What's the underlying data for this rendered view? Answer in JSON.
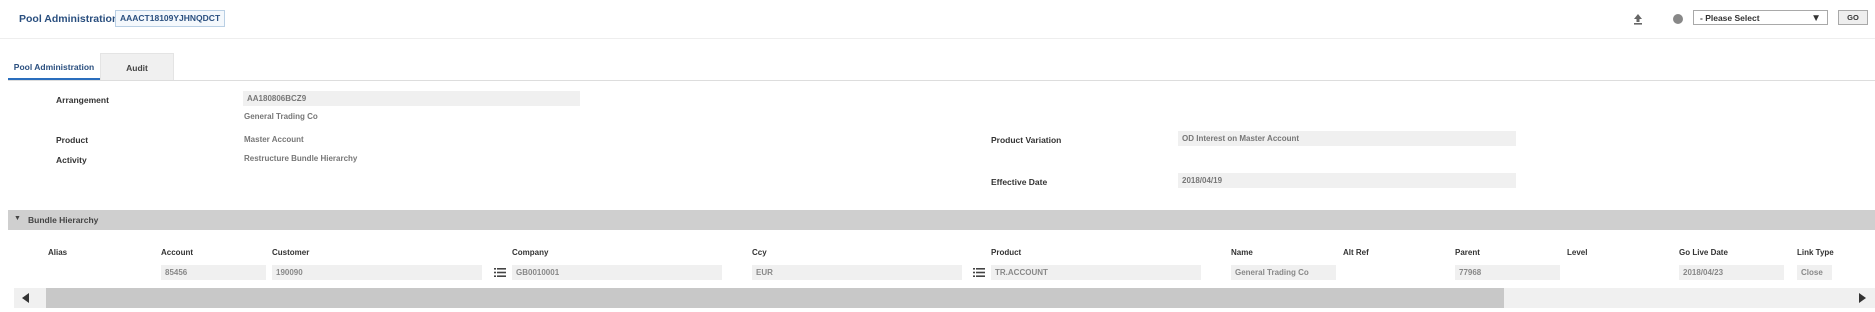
{
  "header": {
    "title": "Pool Administration",
    "reference": "AAACT18109YJHNQDCT",
    "icons": [
      "upload-icon",
      "info-icon"
    ],
    "select_value": "- Please Select",
    "go_label": "GO"
  },
  "tabs": [
    {
      "label": "Pool Administration",
      "active": true
    },
    {
      "label": "Audit",
      "active": false
    }
  ],
  "details": {
    "arrangement_label": "Arrangement",
    "arrangement_value": "AA180806BCZ9",
    "arrangement_sub": "General Trading Co",
    "product_label": "Product",
    "product_value": "Master Account",
    "activity_label": "Activity",
    "activity_value": "Restructure Bundle Hierarchy",
    "product_variation_label": "Product Variation",
    "product_variation_value": "OD Interest on Master Account",
    "effective_date_label": "Effective Date",
    "effective_date_value": "2018/04/19"
  },
  "bundle": {
    "section_title": "Bundle Hierarchy",
    "columns": [
      "Alias",
      "Account",
      "Customer",
      "Company",
      "Ccy",
      "Product",
      "Name",
      "Alt Ref",
      "Parent",
      "Level",
      "Go Live Date",
      "Link Type"
    ],
    "row": {
      "alias": "",
      "account": "85456",
      "customer": "190090",
      "company": "GB0010001",
      "ccy": "EUR",
      "product": "TR.ACCOUNT",
      "name": "General Trading Co",
      "alt_ref": "",
      "parent": "77968",
      "level": "",
      "go_live_date": "2018/04/23",
      "link_type": "Close"
    }
  },
  "colors": {
    "accent": "#2a4f7f",
    "tab_underline": "#2a6ebd",
    "section_bar": "#cfcfcf",
    "field_bg": "#f0f0f0"
  }
}
